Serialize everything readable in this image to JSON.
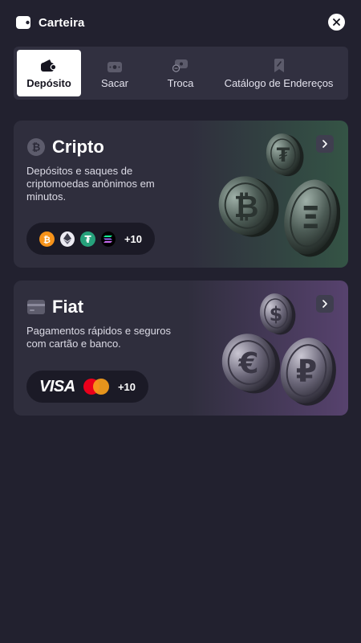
{
  "header": {
    "title": "Carteira",
    "wallet_icon": "wallet-icon",
    "close_icon": "close-icon"
  },
  "tabs": [
    {
      "label": "Depósito",
      "icon": "wallet-deposit-icon",
      "active": true
    },
    {
      "label": "Sacar",
      "icon": "cash-icon",
      "active": false
    },
    {
      "label": "Troca",
      "icon": "exchange-icon",
      "active": false
    },
    {
      "label": "Catálogo de Endereços",
      "icon": "bookmark-icon",
      "active": false
    }
  ],
  "crypto_card": {
    "title": "Cripto",
    "icon": "bitcoin-icon",
    "description": "Depósitos e saques de criptomoedas anônimos em minutos.",
    "coins": [
      "bitcoin-icon",
      "ethereum-icon",
      "tether-icon",
      "solana-icon"
    ],
    "more_count": "+10",
    "illustration_symbols": [
      "₮",
      "₿",
      "Ξ"
    ]
  },
  "fiat_card": {
    "title": "Fiat",
    "icon": "card-icon",
    "description": "Pagamentos rápidos e seguros com cartão e banco.",
    "visa_label": "VISA",
    "more_count": "+10",
    "illustration_symbols": [
      "$",
      "€",
      "₽"
    ]
  },
  "colors": {
    "background": "#22212f",
    "card": "#2f2e3d",
    "crypto_accent": "#345445",
    "fiat_accent": "#57426e",
    "bitcoin": "#f7931a",
    "tether": "#26a17b"
  }
}
